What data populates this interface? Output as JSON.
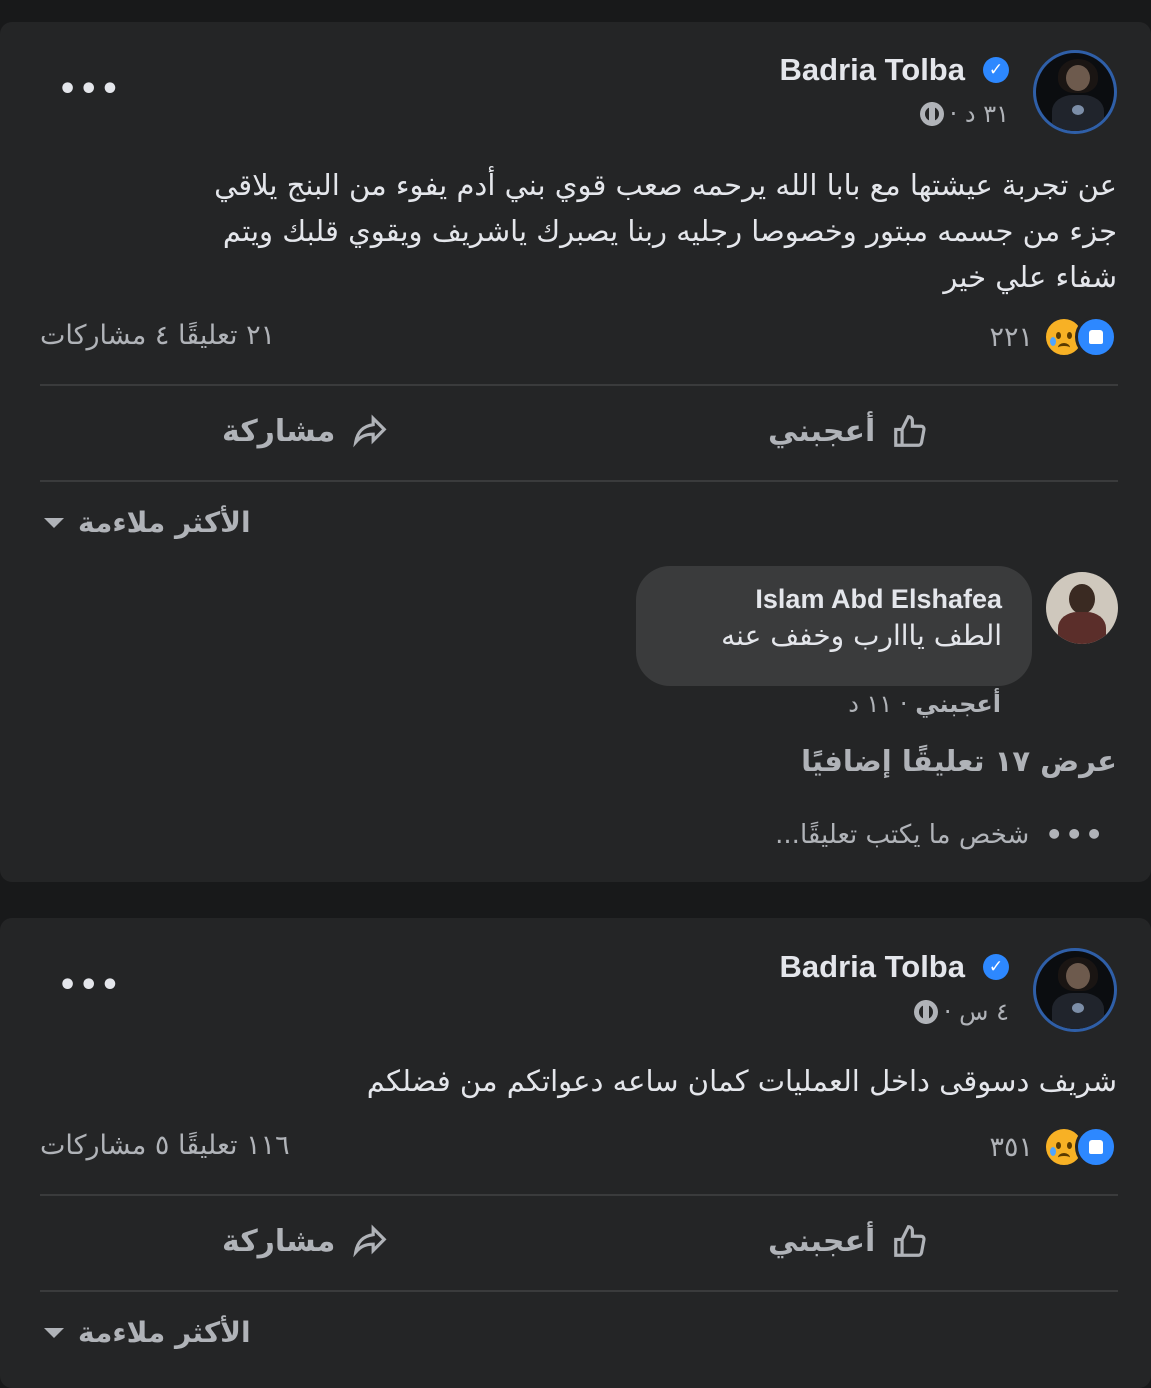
{
  "posts": [
    {
      "author": "Badria Tolba",
      "time": "٣١ د ·",
      "text_lines": [
        "عن تجربة عيشتها مع بابا الله يرحمه صعب قوي بني أدم يفوء من البنج يلاقي",
        "جزء من جسمه مبتور وخصوصا رجليه ربنا يصبرك ياشريف ويقوي قلبك ويتم",
        "شفاء علي خير"
      ],
      "reaction_count": "٢٢١",
      "comments_shares": "٢١ تعليقًا ٤ مشاركات",
      "like_label": "أعجبني",
      "share_label": "مشاركة",
      "sort_label": "الأكثر ملاءمة",
      "comment": {
        "author": "Islam Abd Elshafea",
        "text": "الطف يااارب وخفف عنه",
        "like_label": "أعجبني",
        "time": "· ١١ د"
      },
      "more_comments": "عرض ١٧ تعليقًا إضافيًا",
      "typing": "شخص ما يكتب تعليقًا..."
    },
    {
      "author": "Badria Tolba",
      "time": "٤ س ·",
      "text_lines": [
        "شريف دسوقى داخل العمليات كمان ساعه دعواتكم من فضلكم"
      ],
      "reaction_count": "٣٥١",
      "comments_shares": "١١٦ تعليقًا ٥ مشاركات",
      "like_label": "أعجبني",
      "share_label": "مشاركة",
      "sort_label": "الأكثر ملاءمة"
    }
  ],
  "icons": {
    "more": "more-options-icon",
    "globe": "globe-icon",
    "verified": "verified-badge-icon",
    "like": "like-reaction-icon",
    "sad": "sad-reaction-icon",
    "thumb": "thumbs-up-icon",
    "share": "share-arrow-icon",
    "caret": "caret-down-icon"
  },
  "colors": {
    "background": "#18191a",
    "card": "#242526",
    "text": "#e4e6eb",
    "secondary": "#b0b3b8",
    "accent": "#2d88ff",
    "bubble": "#3a3b3c"
  }
}
